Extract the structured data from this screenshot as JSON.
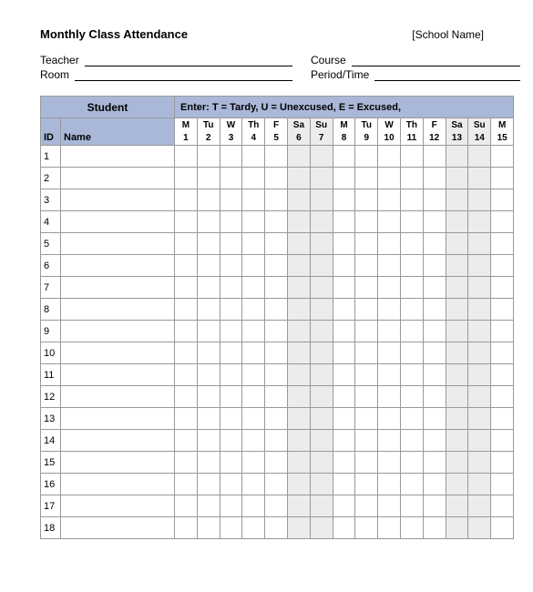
{
  "title": "Monthly Class Attendance",
  "school_placeholder": "[School Name]",
  "meta": {
    "teacher_label": "Teacher",
    "room_label": "Room",
    "course_label": "Course",
    "period_label": "Period/Time"
  },
  "headers": {
    "student": "Student",
    "id": "ID",
    "name": "Name",
    "legend": "Enter:  T = Tardy,   U = Unexcused,   E = Excused,"
  },
  "days": [
    {
      "dow": "M",
      "date": "1",
      "weekend": false
    },
    {
      "dow": "Tu",
      "date": "2",
      "weekend": false
    },
    {
      "dow": "W",
      "date": "3",
      "weekend": false
    },
    {
      "dow": "Th",
      "date": "4",
      "weekend": false
    },
    {
      "dow": "F",
      "date": "5",
      "weekend": false
    },
    {
      "dow": "Sa",
      "date": "6",
      "weekend": true
    },
    {
      "dow": "Su",
      "date": "7",
      "weekend": true
    },
    {
      "dow": "M",
      "date": "8",
      "weekend": false
    },
    {
      "dow": "Tu",
      "date": "9",
      "weekend": false
    },
    {
      "dow": "W",
      "date": "10",
      "weekend": false
    },
    {
      "dow": "Th",
      "date": "11",
      "weekend": false
    },
    {
      "dow": "F",
      "date": "12",
      "weekend": false
    },
    {
      "dow": "Sa",
      "date": "13",
      "weekend": true
    },
    {
      "dow": "Su",
      "date": "14",
      "weekend": true
    },
    {
      "dow": "M",
      "date": "15",
      "weekend": false
    }
  ],
  "rows": [
    "1",
    "2",
    "3",
    "4",
    "5",
    "6",
    "7",
    "8",
    "9",
    "10",
    "11",
    "12",
    "13",
    "14",
    "15",
    "16",
    "17",
    "18"
  ]
}
